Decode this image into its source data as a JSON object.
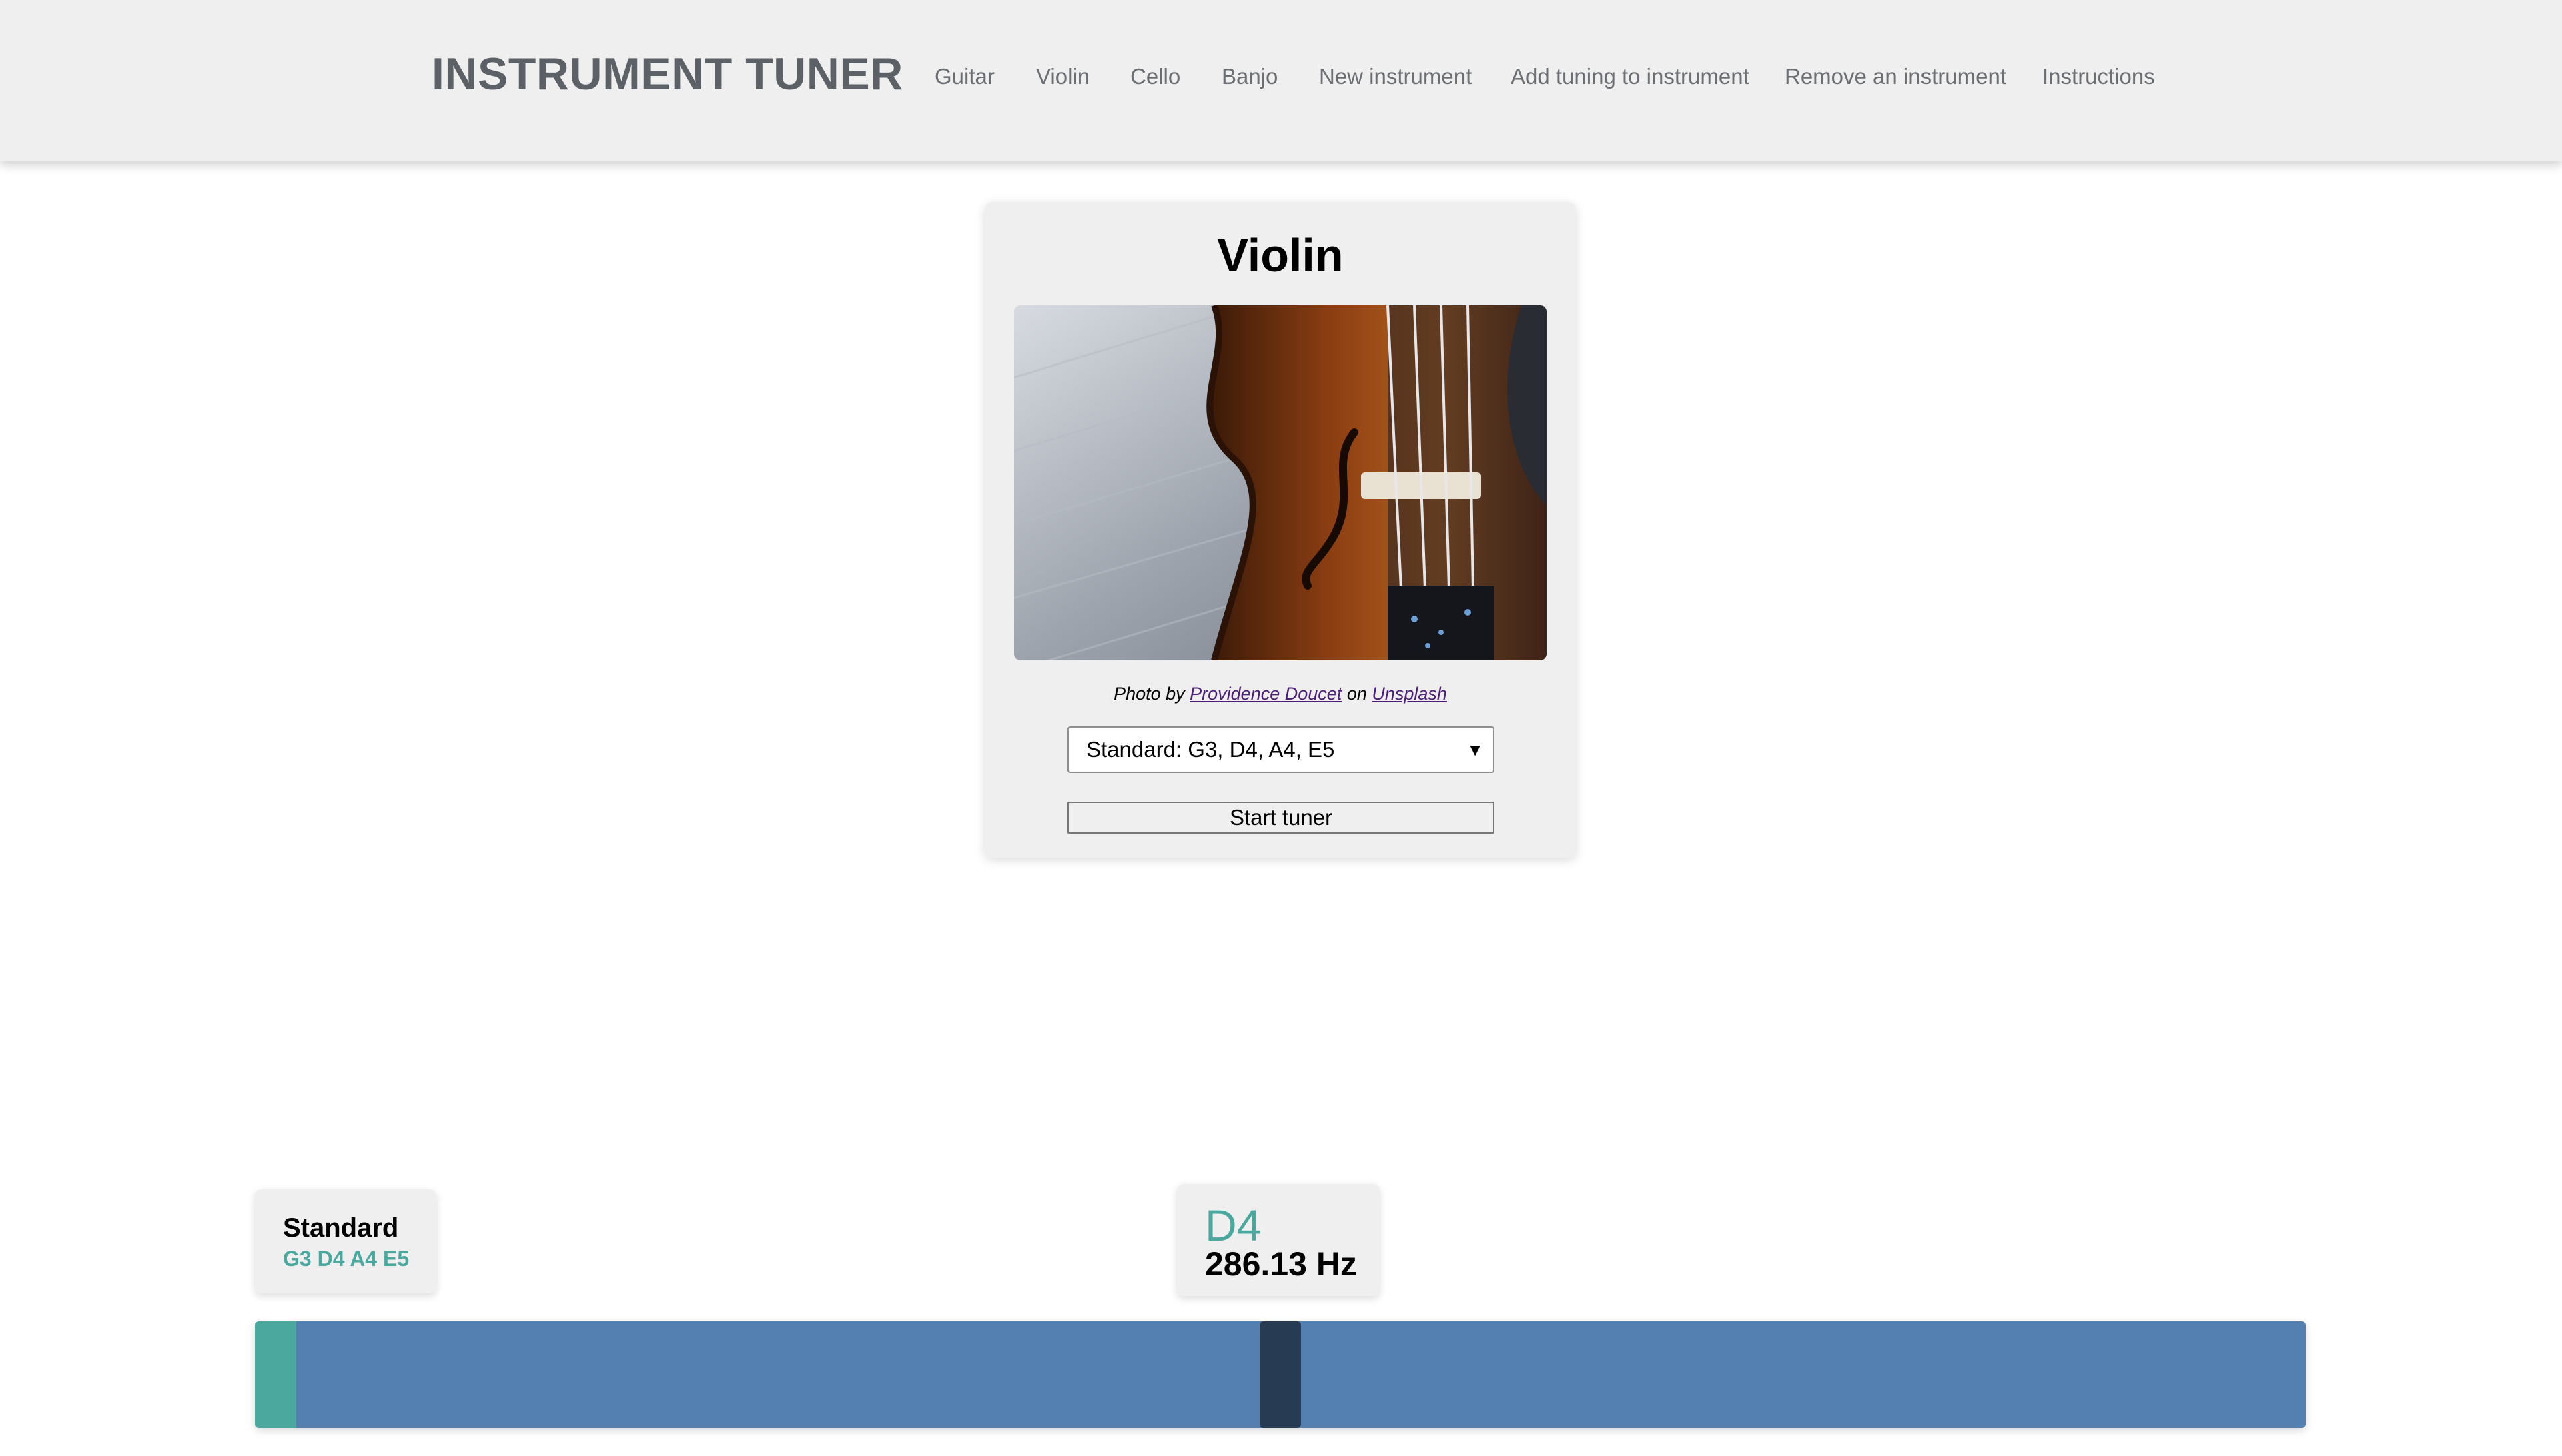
{
  "app": {
    "brand": "INSTRUMENT TUNER"
  },
  "nav": {
    "items": [
      {
        "label": "Guitar"
      },
      {
        "label": "Violin"
      },
      {
        "label": "Cello"
      },
      {
        "label": "Banjo"
      },
      {
        "label": "New instrument"
      },
      {
        "label": "Add tuning to instrument"
      },
      {
        "label": "Remove an instrument"
      },
      {
        "label": "Instructions"
      }
    ]
  },
  "instrument": {
    "title": "Violin",
    "photo_credit": {
      "prefix": "Photo by",
      "author": "Providence Doucet",
      "middle": "on",
      "site": "Unsplash"
    },
    "tuning_select": {
      "selected": "Standard: G3, D4, A4, E5"
    },
    "start_button": "Start tuner"
  },
  "tuner": {
    "tuning_name": "Standard",
    "tuning_notes": "G3 D4 A4 E5",
    "detected_note": "D4",
    "detected_frequency": "286.13 Hz",
    "meter": {
      "needle_fraction": 0.5,
      "target_fraction": 0.0
    }
  },
  "colors": {
    "accent_teal": "#4aa89e",
    "meter_blue": "#5380b0",
    "needle_dark": "#273b52",
    "navbar_bg": "#efefef",
    "brand_text": "#5b6166"
  }
}
